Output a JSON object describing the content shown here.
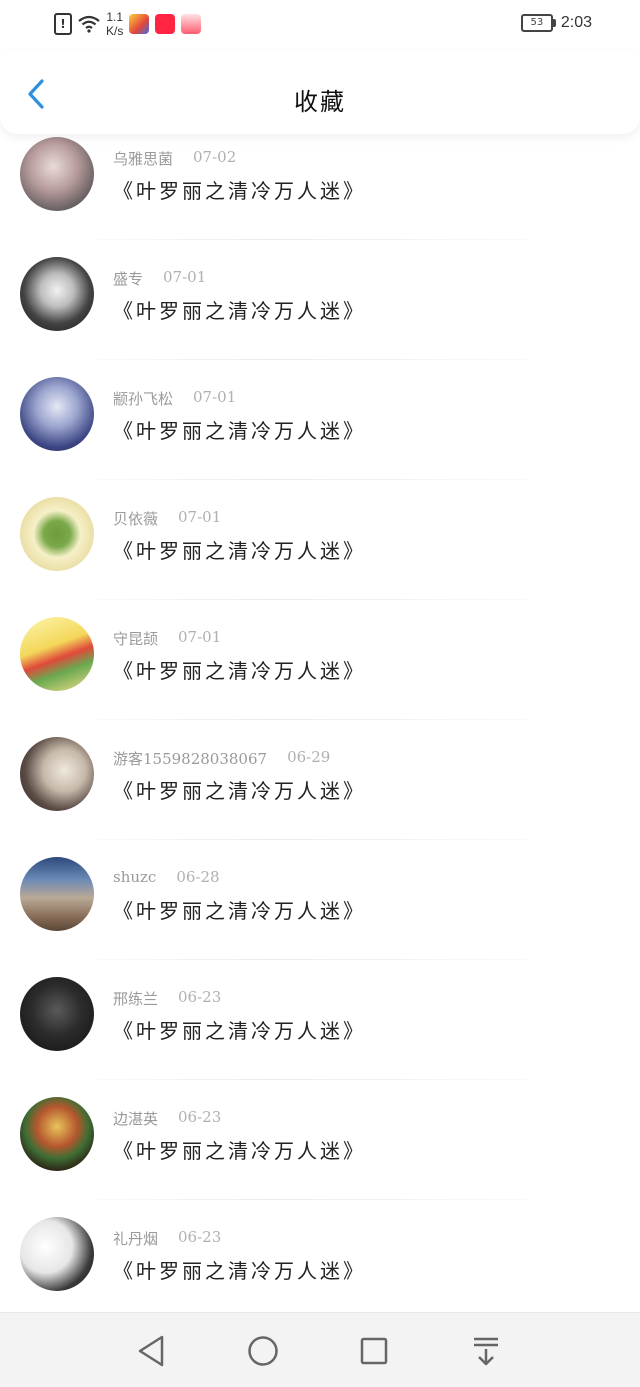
{
  "status_bar": {
    "net_speed_value": "1.1",
    "net_speed_unit": "K/s",
    "battery": "53",
    "time": "2:03",
    "icons": [
      "alert-icon",
      "wifi-icon",
      "app-icon-game",
      "app-icon-xiaohongshu",
      "app-icon-gift"
    ]
  },
  "header": {
    "title": "收藏",
    "back_icon": "chevron-left-icon"
  },
  "favorites": [
    {
      "user": "乌雅思菌",
      "date": "07-02",
      "book": "《叶罗丽之清冷万人迷》"
    },
    {
      "user": "盛专",
      "date": "07-01",
      "book": "《叶罗丽之清冷万人迷》"
    },
    {
      "user": "颛孙飞松",
      "date": "07-01",
      "book": "《叶罗丽之清冷万人迷》"
    },
    {
      "user": "贝依薇",
      "date": "07-01",
      "book": "《叶罗丽之清冷万人迷》"
    },
    {
      "user": "守昆颉",
      "date": "07-01",
      "book": "《叶罗丽之清冷万人迷》"
    },
    {
      "user": "游客1559828038067",
      "date": "06-29",
      "book": "《叶罗丽之清冷万人迷》"
    },
    {
      "user": "shuzc",
      "date": "06-28",
      "book": "《叶罗丽之清冷万人迷》"
    },
    {
      "user": "邢练兰",
      "date": "06-23",
      "book": "《叶罗丽之清冷万人迷》"
    },
    {
      "user": "边湛英",
      "date": "06-23",
      "book": "《叶罗丽之清冷万人迷》"
    },
    {
      "user": "礼丹烟",
      "date": "06-23",
      "book": "《叶罗丽之清冷万人迷》"
    }
  ],
  "nav": {
    "icons": [
      "back-triangle-icon",
      "home-circle-icon",
      "recents-square-icon",
      "notification-pull-icon"
    ]
  },
  "colors": {
    "accent": "#2e8ee0",
    "meta_text": "#9a9a9a",
    "title_text": "#111111",
    "nav_bg": "#f3f3f3"
  }
}
